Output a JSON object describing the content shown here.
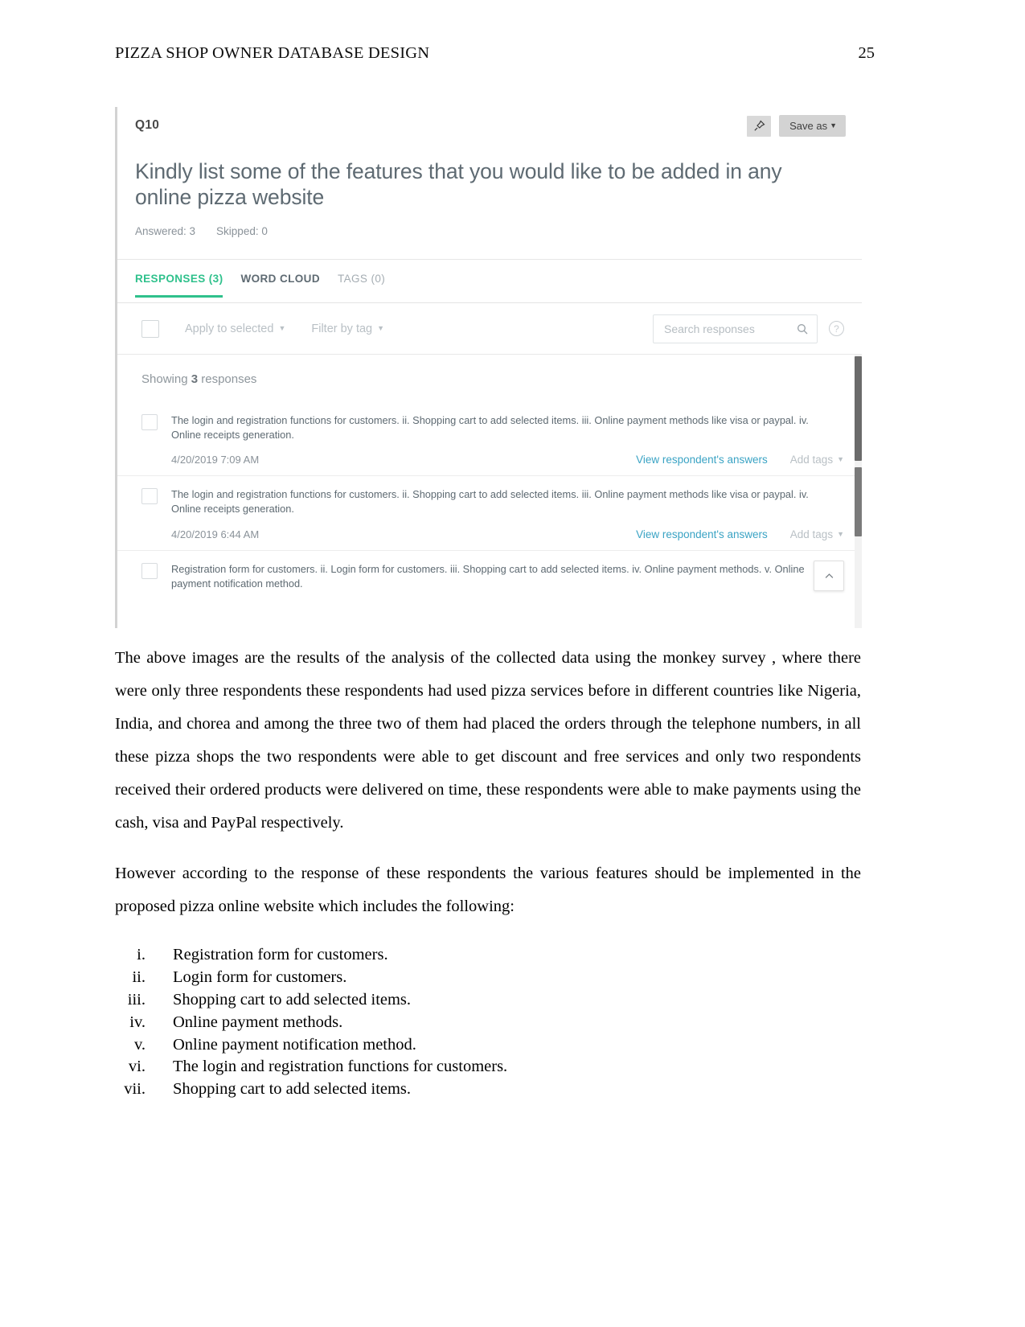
{
  "document": {
    "header_title": "PIZZA SHOP OWNER DATABASE DESIGN",
    "page_number": "25",
    "paragraphs": [
      "The above images are the results of the analysis of the collected data using the monkey survey , where there were only three respondents these respondents had used pizza services before in different countries like Nigeria, India, and chorea and among the three two of them had placed the orders through the telephone numbers, in all these pizza shops the two respondents were able to get discount and free services and only two respondents received their ordered  products were delivered on time, these respondents were able to make payments using the cash, visa and PayPal respectively.",
      "However according to the response of these respondents the various features should be implemented in the proposed pizza online website which includes the following:"
    ],
    "feature_list": [
      {
        "numeral": "i.",
        "text": "Registration form for customers."
      },
      {
        "numeral": "ii.",
        "text": "Login form for customers."
      },
      {
        "numeral": "iii.",
        "text": "Shopping cart to add selected items."
      },
      {
        "numeral": "iv.",
        "text": "Online payment methods."
      },
      {
        "numeral": "v.",
        "text": "Online payment notification method."
      },
      {
        "numeral": "vi.",
        "text": "The login and registration functions for customers."
      },
      {
        "numeral": "vii.",
        "text": "Shopping cart to add selected items."
      }
    ]
  },
  "screenshot": {
    "question_number": "Q10",
    "question_text": "Kindly list some of the features that you would like to be added in any online pizza website",
    "answered_label": "Answered: 3",
    "skipped_label": "Skipped: 0",
    "pin_icon": "pin-icon",
    "save_as_label": "Save as",
    "tabs": [
      {
        "label": "RESPONSES (3)",
        "state": "active"
      },
      {
        "label": "WORD CLOUD",
        "state": "default"
      },
      {
        "label": "TAGS (0)",
        "state": "muted"
      }
    ],
    "toolbar": {
      "apply_to_selected": "Apply to selected",
      "filter_by_tag": "Filter by tag",
      "search_placeholder": "Search responses",
      "search_icon": "search-icon",
      "help_icon": "help-icon",
      "help_glyph": "?"
    },
    "showing_prefix": "Showing ",
    "showing_count": "3",
    "showing_suffix": " responses",
    "view_link_label": "View respondent's answers",
    "add_tags_label": "Add tags",
    "scroll_top_icon": "chevron-up-icon",
    "responses": [
      {
        "text": "The login and registration functions for customers. ii. Shopping cart to add selected items. iii. Online payment methods like visa or paypal. iv. Online receipts generation.",
        "date": "4/20/2019 7:09 AM"
      },
      {
        "text": "The login and registration functions for customers. ii. Shopping cart to add selected items. iii. Online payment methods like visa or paypal. iv. Online receipts generation.",
        "date": "4/20/2019 6:44 AM"
      },
      {
        "text": "Registration form for customers. ii. Login form for customers. iii. Shopping cart to add selected items. iv. Online payment methods. v. Online payment notification method.",
        "date": ""
      }
    ]
  },
  "colors": {
    "accent_green": "#2fc18c",
    "link_blue": "#3aa3c4",
    "body_text": "#000000",
    "muted_grey": "#8a9299"
  }
}
